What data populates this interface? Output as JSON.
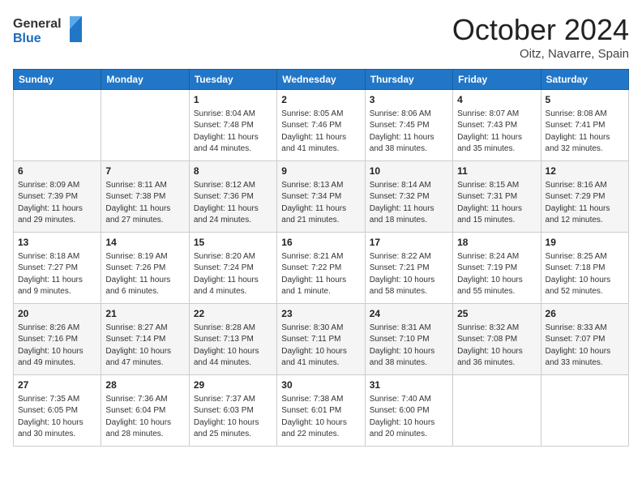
{
  "header": {
    "logo_line1": "General",
    "logo_line2": "Blue",
    "month": "October 2024",
    "location": "Oitz, Navarre, Spain"
  },
  "weekdays": [
    "Sunday",
    "Monday",
    "Tuesday",
    "Wednesday",
    "Thursday",
    "Friday",
    "Saturday"
  ],
  "weeks": [
    [
      {
        "day": "",
        "info": ""
      },
      {
        "day": "",
        "info": ""
      },
      {
        "day": "1",
        "info": "Sunrise: 8:04 AM\nSunset: 7:48 PM\nDaylight: 11 hours and 44 minutes."
      },
      {
        "day": "2",
        "info": "Sunrise: 8:05 AM\nSunset: 7:46 PM\nDaylight: 11 hours and 41 minutes."
      },
      {
        "day": "3",
        "info": "Sunrise: 8:06 AM\nSunset: 7:45 PM\nDaylight: 11 hours and 38 minutes."
      },
      {
        "day": "4",
        "info": "Sunrise: 8:07 AM\nSunset: 7:43 PM\nDaylight: 11 hours and 35 minutes."
      },
      {
        "day": "5",
        "info": "Sunrise: 8:08 AM\nSunset: 7:41 PM\nDaylight: 11 hours and 32 minutes."
      }
    ],
    [
      {
        "day": "6",
        "info": "Sunrise: 8:09 AM\nSunset: 7:39 PM\nDaylight: 11 hours and 29 minutes."
      },
      {
        "day": "7",
        "info": "Sunrise: 8:11 AM\nSunset: 7:38 PM\nDaylight: 11 hours and 27 minutes."
      },
      {
        "day": "8",
        "info": "Sunrise: 8:12 AM\nSunset: 7:36 PM\nDaylight: 11 hours and 24 minutes."
      },
      {
        "day": "9",
        "info": "Sunrise: 8:13 AM\nSunset: 7:34 PM\nDaylight: 11 hours and 21 minutes."
      },
      {
        "day": "10",
        "info": "Sunrise: 8:14 AM\nSunset: 7:32 PM\nDaylight: 11 hours and 18 minutes."
      },
      {
        "day": "11",
        "info": "Sunrise: 8:15 AM\nSunset: 7:31 PM\nDaylight: 11 hours and 15 minutes."
      },
      {
        "day": "12",
        "info": "Sunrise: 8:16 AM\nSunset: 7:29 PM\nDaylight: 11 hours and 12 minutes."
      }
    ],
    [
      {
        "day": "13",
        "info": "Sunrise: 8:18 AM\nSunset: 7:27 PM\nDaylight: 11 hours and 9 minutes."
      },
      {
        "day": "14",
        "info": "Sunrise: 8:19 AM\nSunset: 7:26 PM\nDaylight: 11 hours and 6 minutes."
      },
      {
        "day": "15",
        "info": "Sunrise: 8:20 AM\nSunset: 7:24 PM\nDaylight: 11 hours and 4 minutes."
      },
      {
        "day": "16",
        "info": "Sunrise: 8:21 AM\nSunset: 7:22 PM\nDaylight: 11 hours and 1 minute."
      },
      {
        "day": "17",
        "info": "Sunrise: 8:22 AM\nSunset: 7:21 PM\nDaylight: 10 hours and 58 minutes."
      },
      {
        "day": "18",
        "info": "Sunrise: 8:24 AM\nSunset: 7:19 PM\nDaylight: 10 hours and 55 minutes."
      },
      {
        "day": "19",
        "info": "Sunrise: 8:25 AM\nSunset: 7:18 PM\nDaylight: 10 hours and 52 minutes."
      }
    ],
    [
      {
        "day": "20",
        "info": "Sunrise: 8:26 AM\nSunset: 7:16 PM\nDaylight: 10 hours and 49 minutes."
      },
      {
        "day": "21",
        "info": "Sunrise: 8:27 AM\nSunset: 7:14 PM\nDaylight: 10 hours and 47 minutes."
      },
      {
        "day": "22",
        "info": "Sunrise: 8:28 AM\nSunset: 7:13 PM\nDaylight: 10 hours and 44 minutes."
      },
      {
        "day": "23",
        "info": "Sunrise: 8:30 AM\nSunset: 7:11 PM\nDaylight: 10 hours and 41 minutes."
      },
      {
        "day": "24",
        "info": "Sunrise: 8:31 AM\nSunset: 7:10 PM\nDaylight: 10 hours and 38 minutes."
      },
      {
        "day": "25",
        "info": "Sunrise: 8:32 AM\nSunset: 7:08 PM\nDaylight: 10 hours and 36 minutes."
      },
      {
        "day": "26",
        "info": "Sunrise: 8:33 AM\nSunset: 7:07 PM\nDaylight: 10 hours and 33 minutes."
      }
    ],
    [
      {
        "day": "27",
        "info": "Sunrise: 7:35 AM\nSunset: 6:05 PM\nDaylight: 10 hours and 30 minutes."
      },
      {
        "day": "28",
        "info": "Sunrise: 7:36 AM\nSunset: 6:04 PM\nDaylight: 10 hours and 28 minutes."
      },
      {
        "day": "29",
        "info": "Sunrise: 7:37 AM\nSunset: 6:03 PM\nDaylight: 10 hours and 25 minutes."
      },
      {
        "day": "30",
        "info": "Sunrise: 7:38 AM\nSunset: 6:01 PM\nDaylight: 10 hours and 22 minutes."
      },
      {
        "day": "31",
        "info": "Sunrise: 7:40 AM\nSunset: 6:00 PM\nDaylight: 10 hours and 20 minutes."
      },
      {
        "day": "",
        "info": ""
      },
      {
        "day": "",
        "info": ""
      }
    ]
  ]
}
